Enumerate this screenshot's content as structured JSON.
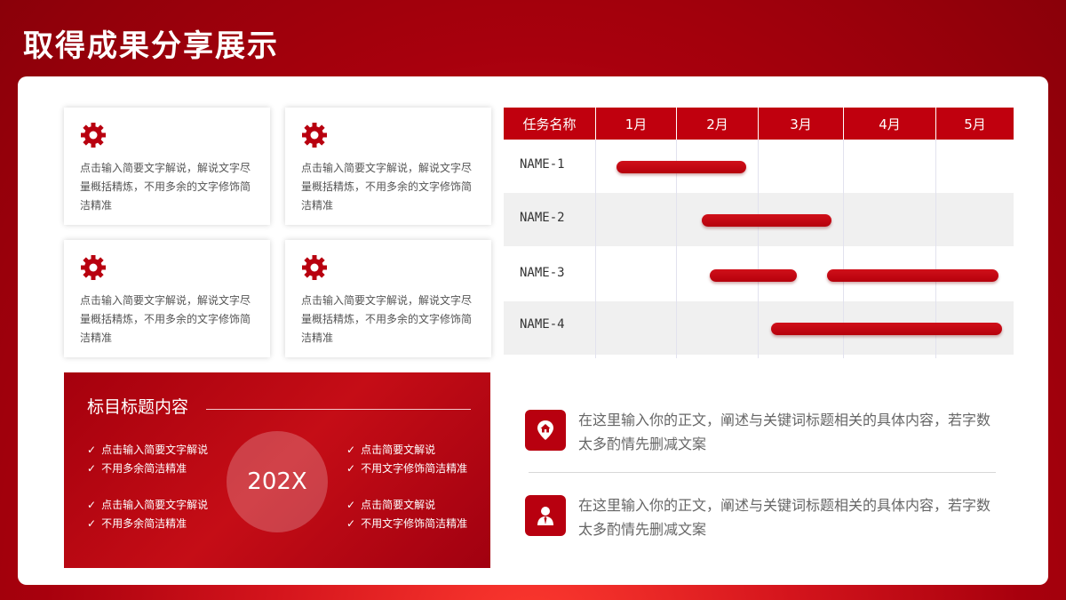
{
  "page": {
    "title": "取得成果分享展示"
  },
  "cards": [
    {
      "icon": "gear-icon",
      "text": "点击输入简要文字解说，解说文字尽量概括精炼，不用多余的文字修饰简洁精准"
    },
    {
      "icon": "gear-icon",
      "text": "点击输入简要文字解说，解说文字尽量概括精炼，不用多余的文字修饰简洁精准"
    },
    {
      "icon": "gear-icon",
      "text": "点击输入简要文字解说，解说文字尽量概括精炼，不用多余的文字修饰简洁精准"
    },
    {
      "icon": "gear-icon",
      "text": "点击输入简要文字解说，解说文字尽量概括精炼，不用多余的文字修饰简洁精准"
    }
  ],
  "summary": {
    "title": "标目标题内容",
    "center": "202X",
    "left_items": [
      "点击输入简要文字解说",
      "不用多余简洁精准",
      "点击输入简要文字解说",
      "不用多余简洁精准"
    ],
    "right_items": [
      "点击简要文解说",
      "不用文字修饰简洁精准",
      "点击简要文解说",
      "不用文字修饰简洁精准"
    ],
    "check_glyph": "✓"
  },
  "gantt": {
    "header_task": "任务名称",
    "months": [
      "1月",
      "2月",
      "3月",
      "4月",
      "5月"
    ],
    "rows": [
      {
        "name": "NAME-1",
        "bars": [
          [
            0.25,
            1.85
          ]
        ]
      },
      {
        "name": "NAME-2",
        "bars": [
          [
            1.3,
            2.85
          ]
        ]
      },
      {
        "name": "NAME-3",
        "bars": [
          [
            1.4,
            2.45
          ],
          [
            2.8,
            4.8
          ]
        ]
      },
      {
        "name": "NAME-4",
        "bars": [
          [
            2.15,
            4.85
          ]
        ]
      }
    ]
  },
  "notes": [
    {
      "icon": "home-location-icon",
      "text": "在这里输入你的正文，阐述与关键词标题相关的具体内容，若字数太多酌情先删减文案"
    },
    {
      "icon": "user-icon",
      "text": "在这里输入你的正文，阐述与关键词标题相关的具体内容，若字数太多酌情先删减文案"
    }
  ],
  "colors": {
    "accent": "#c0000e",
    "background": "#a8000d"
  }
}
